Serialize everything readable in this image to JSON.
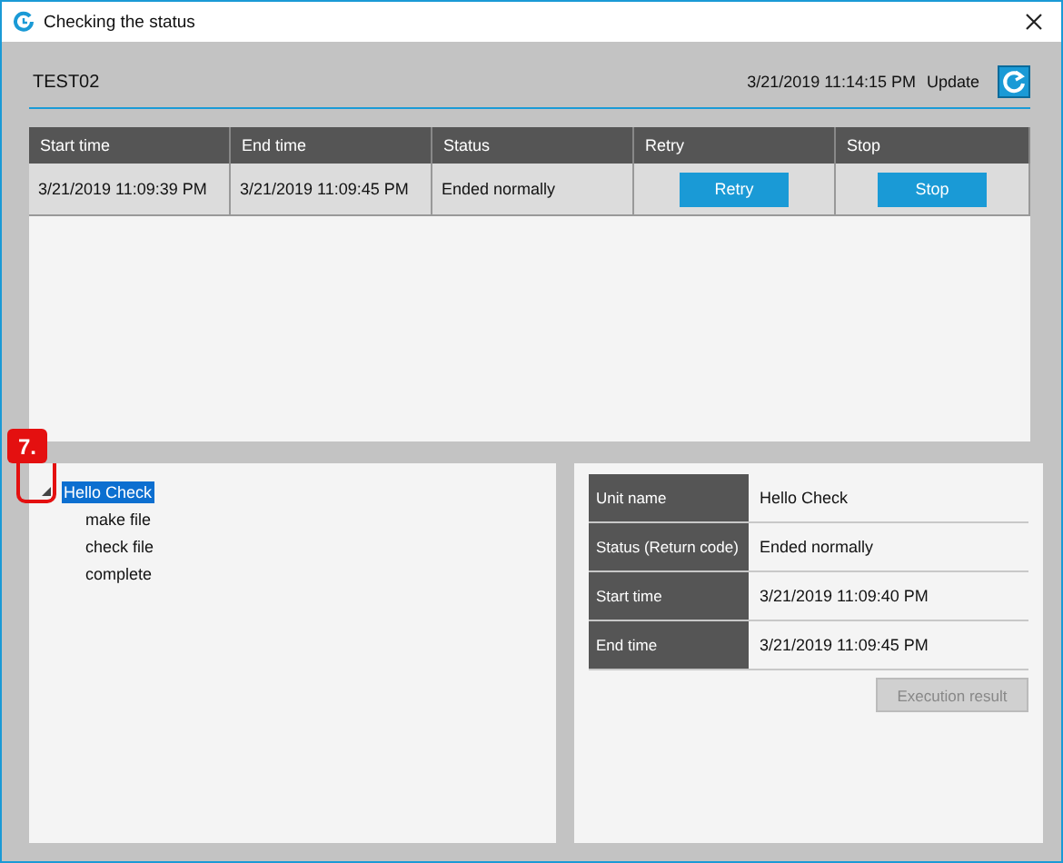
{
  "window": {
    "title": "Checking the status"
  },
  "header": {
    "job_name": "TEST02",
    "timestamp": "3/21/2019 11:14:15 PM",
    "update_label": "Update"
  },
  "table": {
    "columns": [
      "Start time",
      "End time",
      "Status",
      "Retry",
      "Stop"
    ],
    "rows": [
      {
        "start_time": "3/21/2019 11:09:39 PM",
        "end_time": "3/21/2019 11:09:45 PM",
        "status": "Ended normally",
        "retry_button": "Retry",
        "stop_button": "Stop"
      }
    ]
  },
  "callout": {
    "label": "7."
  },
  "tree": [
    {
      "label": "Hello Check",
      "selected": true,
      "expanded": true,
      "children": [
        {
          "label": "make file",
          "selected": false
        },
        {
          "label": "check file",
          "selected": false
        },
        {
          "label": "complete",
          "selected": false
        }
      ]
    }
  ],
  "details": [
    {
      "label": "Unit name",
      "value": "Hello Check"
    },
    {
      "label": "Status (Return code)",
      "value": "Ended normally"
    },
    {
      "label": "Start time",
      "value": "3/21/2019 11:09:40 PM"
    },
    {
      "label": "End time",
      "value": "3/21/2019 11:09:45 PM"
    }
  ],
  "execution_result_button": {
    "label": "Execution result",
    "disabled": true
  }
}
